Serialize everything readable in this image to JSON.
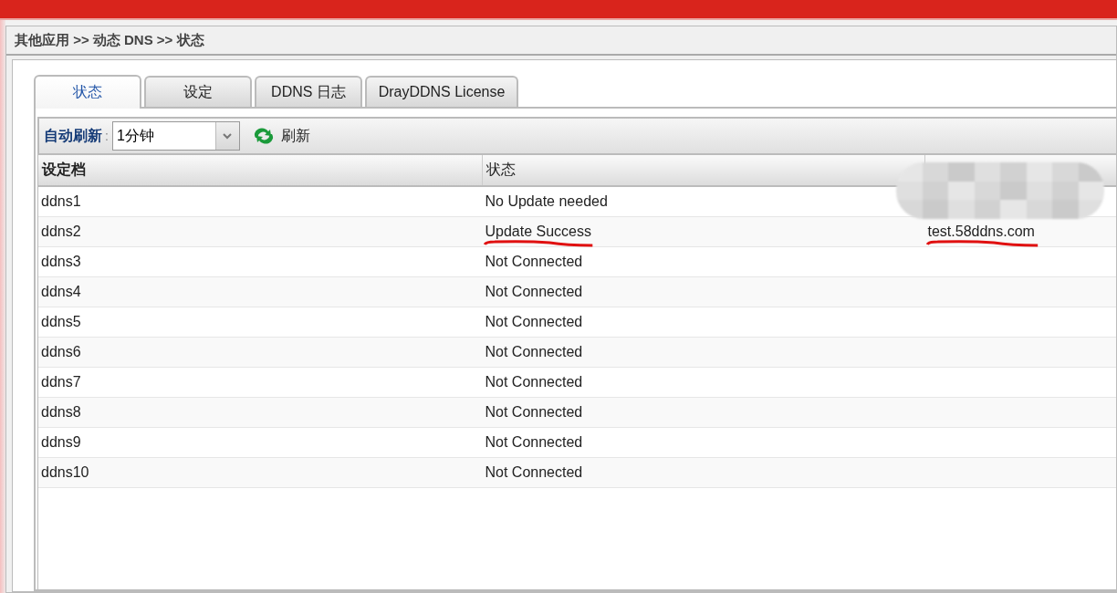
{
  "breadcrumb": "其他应用 >> 动态 DNS >> 状态",
  "tabs": [
    {
      "label": "状态",
      "selected": true
    },
    {
      "label": "设定",
      "selected": false
    },
    {
      "label": "DDNS 日志",
      "selected": false
    },
    {
      "label": "DrayDDNS License",
      "selected": false
    }
  ],
  "toolbar": {
    "auto_refresh_label": "自动刷新",
    "separator": ":",
    "interval": "1分钟",
    "refresh_button": "刷新"
  },
  "table": {
    "columns": [
      {
        "label": "设定档"
      },
      {
        "label": "状态"
      },
      {
        "redacted": true
      }
    ],
    "rows": [
      {
        "cells": [
          {
            "text": "ddns1"
          },
          {
            "text": "No Update needed"
          },
          {
            "redacted": true
          }
        ]
      },
      {
        "cells": [
          {
            "text": "ddns2"
          },
          {
            "text": "Update Success",
            "underlined": true
          },
          {
            "text": "test.58ddns.com",
            "underlined": true
          }
        ]
      },
      {
        "cells": [
          {
            "text": "ddns3"
          },
          {
            "text": "Not Connected"
          }
        ]
      },
      {
        "cells": [
          {
            "text": "ddns4"
          },
          {
            "text": "Not Connected"
          }
        ]
      },
      {
        "cells": [
          {
            "text": "ddns5"
          },
          {
            "text": "Not Connected"
          }
        ]
      },
      {
        "cells": [
          {
            "text": "ddns6"
          },
          {
            "text": "Not Connected"
          }
        ]
      },
      {
        "cells": [
          {
            "text": "ddns7"
          },
          {
            "text": "Not Connected"
          }
        ]
      },
      {
        "cells": [
          {
            "text": "ddns8"
          },
          {
            "text": "Not Connected"
          }
        ]
      },
      {
        "cells": [
          {
            "text": "ddns9"
          },
          {
            "text": "Not Connected"
          }
        ]
      },
      {
        "cells": [
          {
            "text": "ddns10"
          },
          {
            "text": "Not Connected"
          }
        ]
      }
    ]
  }
}
